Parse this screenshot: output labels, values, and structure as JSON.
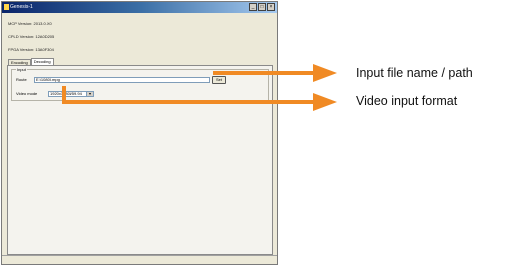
{
  "window": {
    "title": "Genesis-1",
    "controls": {
      "minimize": "_",
      "maximize": "□",
      "close": "×"
    }
  },
  "info": {
    "mcp_version": "MCP Version: 2013.0.X0",
    "cpld_version": "CPLD Version: 12A0D205",
    "fpga_version": "FPGA Version: 13A0F304"
  },
  "tabs": [
    {
      "label": "Encoding"
    },
    {
      "label": "Decoding"
    }
  ],
  "decoding": {
    "group_label": "Input",
    "route_label": "Route",
    "file_path": "E:\\1080I.mpg",
    "set_button": "Set",
    "video_mode_label": "Video mode",
    "video_mode_value": "1920x1080i/59.94"
  },
  "callouts": {
    "input_file": "Input file name / path",
    "video_format": "Video input format"
  },
  "colors": {
    "arrow": "#f08a24",
    "titlebar": "#0a246a"
  }
}
